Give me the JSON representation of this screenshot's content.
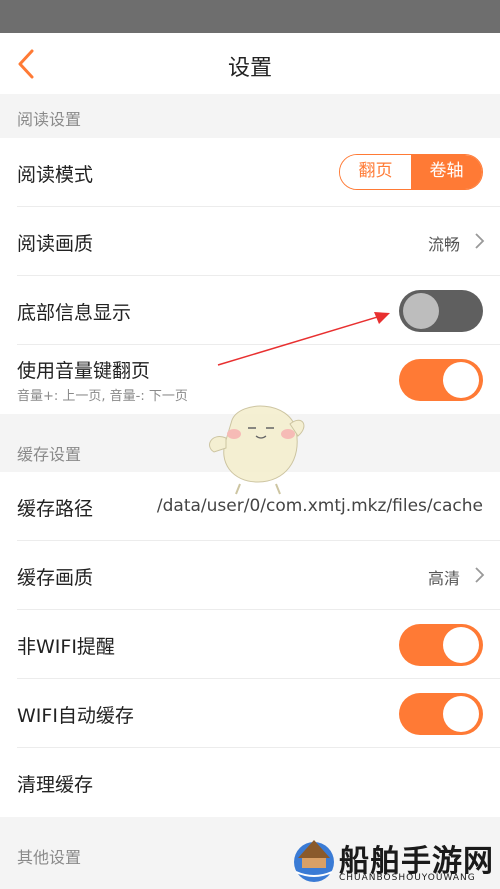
{
  "header": {
    "title": "设置"
  },
  "sections": {
    "reading": "阅读设置",
    "cache": "缓存设置",
    "other": "其他设置"
  },
  "rows": {
    "read_mode": {
      "label": "阅读模式",
      "options": [
        "翻页",
        "卷轴"
      ],
      "selected": "卷轴"
    },
    "read_quality": {
      "label": "阅读画质",
      "value": "流畅"
    },
    "bottom_info": {
      "label": "底部信息显示",
      "enabled": false
    },
    "volume_keys": {
      "label": "使用音量键翻页",
      "sub": "音量+: 上一页, 音量-: 下一页",
      "enabled": true
    },
    "cache_path": {
      "label": "缓存路径",
      "value": "/data/user/0/com.xmtj.mkz/files/cache"
    },
    "cache_quality": {
      "label": "缓存画质",
      "value": "高清"
    },
    "non_wifi_alert": {
      "label": "非WIFI提醒",
      "enabled": true
    },
    "wifi_auto_cache": {
      "label": "WIFI自动缓存",
      "enabled": true
    },
    "clear_cache": {
      "label": "清理缓存"
    }
  },
  "watermark": {
    "text": "船舶手游网",
    "sub": "CHUANBOSHOUYOUWANG"
  },
  "colors": {
    "accent": "#ff7a35",
    "annotation": "#e83030",
    "toggle_off": "#5f5f5f"
  },
  "icons": {
    "back": "chevron-left-icon",
    "chevron": "chevron-right-icon"
  }
}
